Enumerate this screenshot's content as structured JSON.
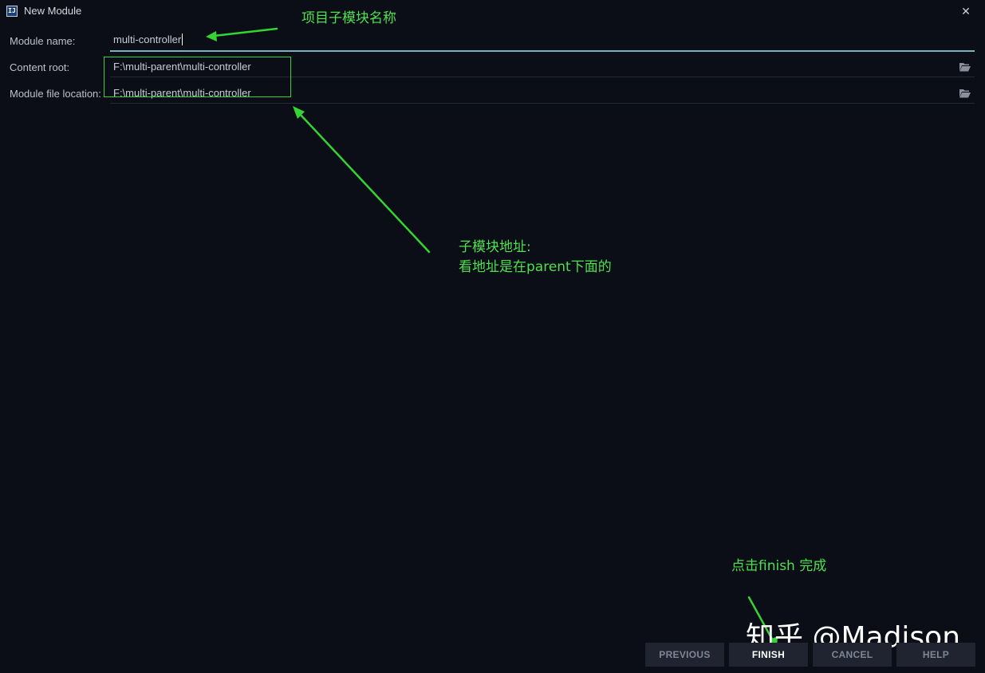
{
  "window": {
    "title": "New Module",
    "app_icon_text": "IJ",
    "close_glyph": "✕"
  },
  "form": {
    "module_name": {
      "label": "Module name:",
      "value": "multi-controller"
    },
    "content_root": {
      "label": "Content root:",
      "value": "F:\\multi-parent\\multi-controller"
    },
    "module_file_location": {
      "label": "Module file location:",
      "value": "F:\\multi-parent\\multi-controller"
    }
  },
  "icons": {
    "folder": "folder-open-icon",
    "close": "close-icon"
  },
  "annotations": {
    "module_name_note": "项目子模块名称",
    "location_note_line1": "子模块地址:",
    "location_note_line2": "看地址是在parent下面的",
    "finish_note": "点击finish 完成",
    "color": "#33d433"
  },
  "watermark": "知乎 @Madison",
  "buttons": {
    "previous": "PREVIOUS",
    "finish": "FINISH",
    "cancel": "CANCEL",
    "help": "HELP"
  },
  "colors": {
    "background": "#0b0e16",
    "button_bg": "#1f2430",
    "focus_underline": "#7fb0bd"
  }
}
